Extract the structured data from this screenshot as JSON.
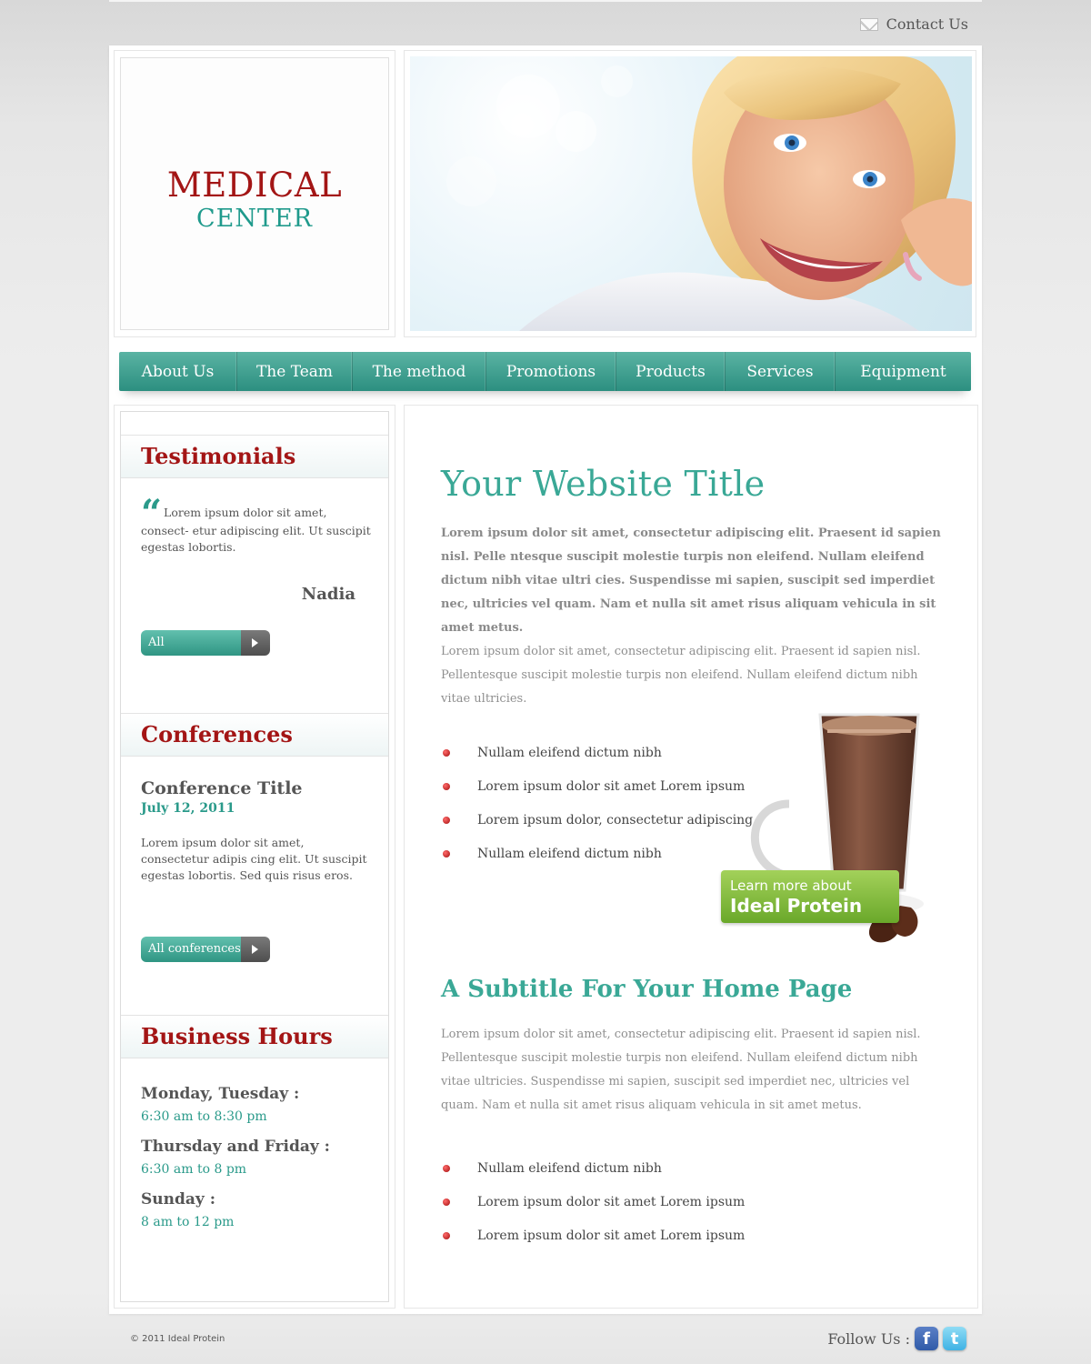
{
  "header": {
    "contact_label": "Contact Us",
    "logo_line1": "MEDICAL",
    "logo_line2": "CENTER"
  },
  "nav": {
    "items": [
      "About Us",
      "The Team",
      "The method",
      "Promotions",
      "Products",
      "Services",
      "Equipment"
    ]
  },
  "sidebar": {
    "testimonials": {
      "heading": "Testimonials",
      "quote": "Lorem ipsum dolor sit amet, consect- etur adipiscing elit. Ut suscipit egestas lobortis.",
      "author": "Nadia",
      "button_label": "All testimonials"
    },
    "conferences": {
      "heading": "Conferences",
      "title": "Conference Title",
      "date": "July 12, 2011",
      "text": "Lorem ipsum dolor sit amet, consectetur adipis cing elit. Ut suscipit egestas lobortis. Sed quis risus eros.",
      "button_label": "All conferences"
    },
    "business_hours": {
      "heading": "Business Hours",
      "entries": [
        {
          "days": "Monday, Tuesday :",
          "hours": "6:30 am to 8:30 pm"
        },
        {
          "days": "Thursday and Friday :",
          "hours": "6:30 am to 8 pm"
        },
        {
          "days": "Sunday :",
          "hours": "8 am to 12 pm"
        }
      ]
    }
  },
  "main": {
    "title": "Your Website Title",
    "intro_bold": "Lorem ipsum dolor sit amet, consectetur adipiscing elit. Praesent id sapien nisl. Pelle ntesque suscipit molestie turpis non eleifend. Nullam eleifend dictum nibh vitae ultri cies. Suspendisse mi sapien, suscipit sed imperdiet nec, ultricies vel quam. Nam et nulla sit amet risus aliquam vehicula in sit amet metus.",
    "paragraph": "Lorem ipsum dolor sit amet, consectetur adipiscing elit. Praesent id sapien nisl. Pellentesque suscipit molestie turpis non eleifend. Nullam eleifend dictum nibh vitae ultricies.",
    "bullets_1": [
      "Nullam eleifend dictum nibh",
      "Lorem ipsum dolor sit amet Lorem ipsum",
      "Lorem ipsum dolor, consectetur adipiscing",
      "Nullam eleifend dictum nibh"
    ],
    "promo": {
      "line1": "Learn more about",
      "line2": "Ideal Protein"
    },
    "subtitle": "A Subtitle For Your Home Page",
    "paragraph_2": "Lorem ipsum dolor sit amet, consectetur adipiscing elit. Praesent id sapien nisl. Pellentesque suscipit molestie turpis non eleifend. Nullam eleifend dictum nibh vitae ultricies. Suspendisse mi sapien, suscipit sed imperdiet nec, ultricies vel quam. Nam et nulla sit amet risus aliquam vehicula in sit amet metus.",
    "bullets_2": [
      "Nullam eleifend dictum nibh",
      "Lorem ipsum dolor sit amet Lorem ipsum",
      "Lorem ipsum dolor sit amet Lorem ipsum"
    ]
  },
  "footer": {
    "copyright": "© 2011 Ideal Protein",
    "follow_label": "Follow Us :",
    "facebook_glyph": "f",
    "twitter_glyph": "t"
  },
  "colors": {
    "accent_teal": "#3aa896",
    "brand_red": "#a31515",
    "promo_green": "#8cc63f"
  },
  "icons": [
    "envelope-icon",
    "quote-icon",
    "arrow-right-icon",
    "bullet-icon",
    "facebook-icon",
    "twitter-icon"
  ]
}
